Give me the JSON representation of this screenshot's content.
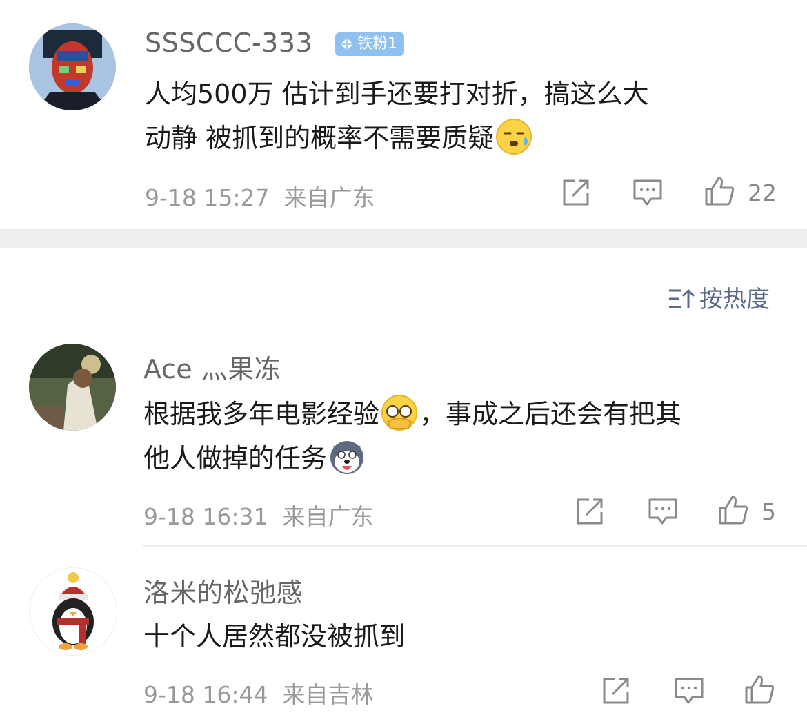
{
  "comments": [
    {
      "username": "SSSCCC-333",
      "badge": "铁粉1",
      "text_lines": [
        "人均500万 估计到手还要打对折，搞这么大",
        "动静 被抓到的概率不需要质疑"
      ],
      "emoji": "sweat-smile-emoji",
      "time": "9-18 15:27",
      "location": "来自广东",
      "likes": "22"
    },
    {
      "username": "Ace 灬果冻",
      "text_lines": [
        "根据我多年电影经验",
        "，事成之后还会有把其",
        "他人做掉的任务"
      ],
      "emoji_1": "peek-eyes-emoji",
      "emoji_2": "husky-dog-emoji",
      "time": "9-18 16:31",
      "location": "来自广东",
      "likes": "5"
    },
    {
      "username": "洛米的松弛感",
      "text_lines": [
        "十个人居然都没被抓到"
      ],
      "time": "9-18 16:44",
      "location": "来自吉林",
      "likes": ""
    }
  ],
  "sort": {
    "label": "按热度",
    "icon": "sort-icon"
  },
  "colors": {
    "meta": "#999999",
    "username": "#666666",
    "badge": "#8fc1f0",
    "sort": "#5a6b88"
  }
}
